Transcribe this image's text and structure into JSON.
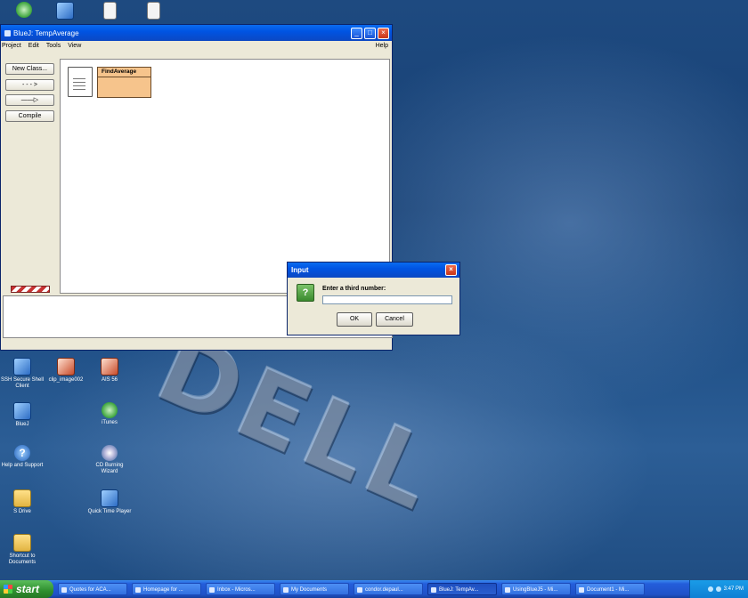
{
  "desktop": {
    "top_icons": [
      {
        "icon": "recycle-bin-icon"
      },
      {
        "icon": "network-icon"
      },
      {
        "icon": "document-icon"
      },
      {
        "icon": "document-icon"
      }
    ],
    "icons": [
      {
        "label": "SSH Secure Shell Client",
        "icon": "ssh-icon"
      },
      {
        "label": "clip_image002",
        "icon": "image-file-icon"
      },
      {
        "label": "AIS 56",
        "icon": "image-file-icon"
      },
      {
        "label": "BlueJ",
        "icon": "bluej-icon"
      },
      {
        "label": "iTunes",
        "icon": "itunes-icon"
      },
      {
        "label": "Help and Support",
        "icon": "help-icon"
      },
      {
        "label": "CD Burning Wizard",
        "icon": "cd-icon"
      },
      {
        "label": "S Drive",
        "icon": "folder-icon"
      },
      {
        "label": "Quick Time Player",
        "icon": "quicktime-icon"
      },
      {
        "label": "Shortcut to Documents",
        "icon": "folder-icon"
      }
    ],
    "wallpaper_logo": "DELL"
  },
  "bluej": {
    "title": "BlueJ: TempAverage",
    "menus": [
      "Project",
      "Edit",
      "Tools",
      "View"
    ],
    "help_menu": "Help",
    "buttons": {
      "new_class": "New Class...",
      "uses_arrow": "- - - >",
      "inherit_arrow": "——▷",
      "compile": "Compile"
    },
    "class_name": "FindAverage"
  },
  "dialog": {
    "title": "Input",
    "prompt": "Enter a third number:",
    "input_value": "",
    "ok": "OK",
    "cancel": "Cancel"
  },
  "taskbar": {
    "start": "start",
    "tasks": [
      {
        "label": "Quotes for ACA..."
      },
      {
        "label": "Homepage for ..."
      },
      {
        "label": "Inbox - Micros..."
      },
      {
        "label": "My Documents"
      },
      {
        "label": "condor.depaul..."
      },
      {
        "label": "BlueJ: TempAv..."
      },
      {
        "label": "UsingBlueJ5 - Mi..."
      },
      {
        "label": "Document1 - Mi..."
      }
    ],
    "clock": "3:47 PM"
  }
}
